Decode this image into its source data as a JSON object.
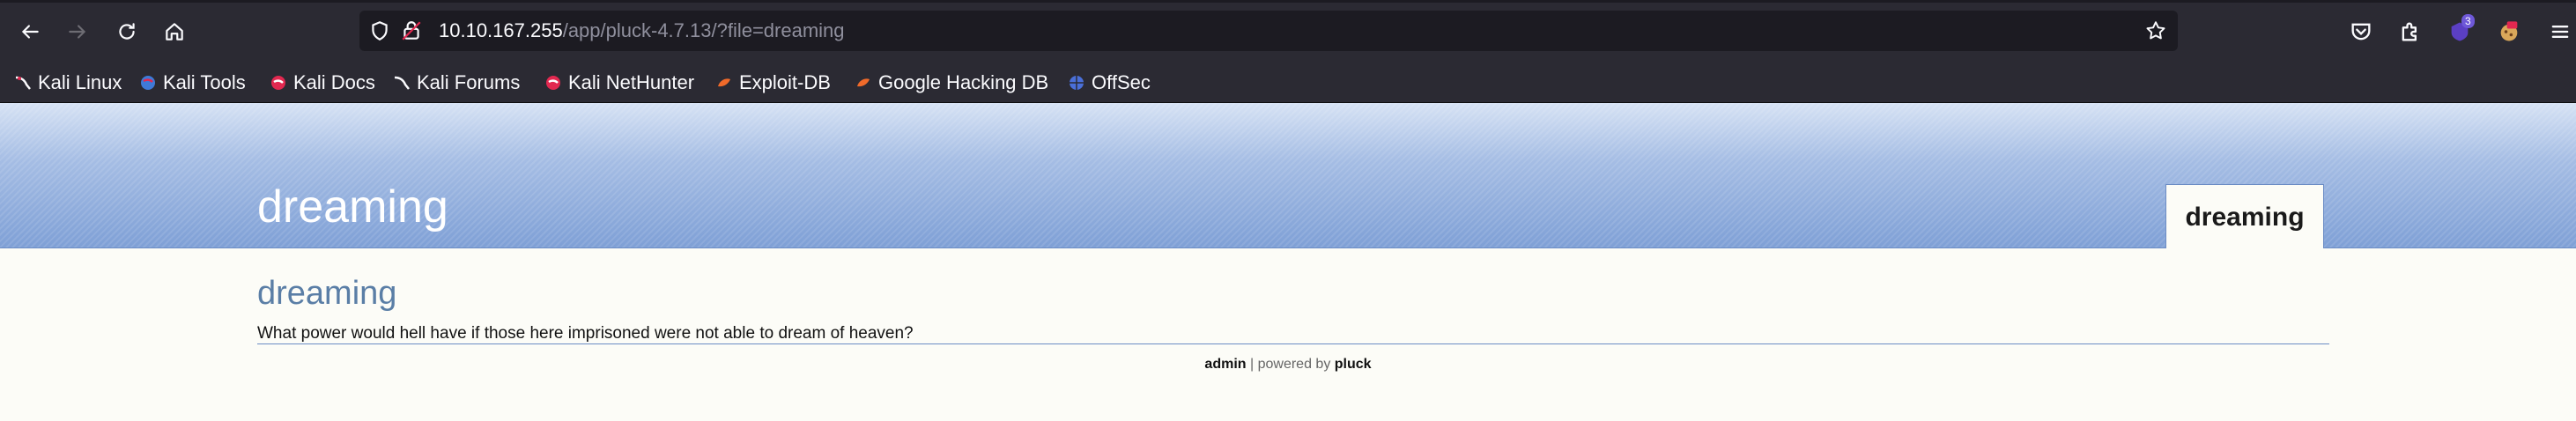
{
  "browser": {
    "url_host": "10.10.167.255",
    "url_path": "/app/pluck-4.7.13/?file=dreaming",
    "extension_badge": "3",
    "bookmarks": [
      {
        "label": "Kali Linux",
        "icon": "kali-dragon-icon"
      },
      {
        "label": "Kali Tools",
        "icon": "kali-tools-icon"
      },
      {
        "label": "Kali Docs",
        "icon": "kali-docs-icon"
      },
      {
        "label": "Kali Forums",
        "icon": "kali-forums-icon"
      },
      {
        "label": "Kali NetHunter",
        "icon": "kali-nethunter-icon"
      },
      {
        "label": "Exploit-DB",
        "icon": "exploit-db-icon"
      },
      {
        "label": "Google Hacking DB",
        "icon": "ghdb-icon"
      },
      {
        "label": "OffSec",
        "icon": "offsec-icon"
      }
    ]
  },
  "site": {
    "title": "dreaming",
    "nav": [
      {
        "label": "dreaming"
      }
    ],
    "page": {
      "title": "dreaming",
      "text": "What power would hell have if those here imprisoned were not able to dream of heaven?"
    },
    "footer": {
      "admin": "admin",
      "separator": " | powered by ",
      "pluck": "pluck"
    }
  },
  "colors": {
    "chrome_bg": "#2b2a33",
    "url_bg": "#1c1b22",
    "header_blue": "#7fa0d6",
    "page_title": "#5a7ea6",
    "page_bg": "#fcfcf7"
  }
}
